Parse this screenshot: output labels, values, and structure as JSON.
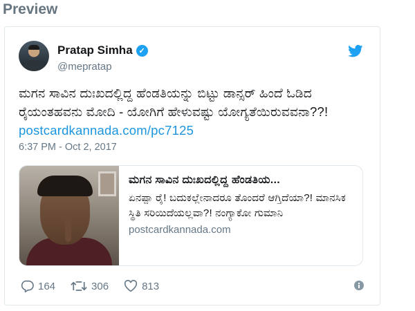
{
  "heading": "Preview",
  "tweet": {
    "display_name": "Pratap Simha",
    "handle": "@mepratap",
    "text_main": "ಮಗನ ಸಾವಿನ ದುಃಖದಲ್ಲಿದ್ದ ಹೆಂಡತಿಯನ್ನು ಬಿಟ್ಟು ಡಾನ್ಸರ್ ಹಿಂದೆ ಓಡಿದ ರೈಯಂತಹವನು ಮೋದಿ - ಯೋಗಿಗೆ ಹೇಳುವಷ್ಟು ಯೋಗ್ಯತೆಯಿರುವವನಾ??!",
    "text_link": "postcardkannada.com/pc7125",
    "timestamp": "6:37 PM - Oct 2, 2017",
    "card": {
      "title": "ಮಗನ ಸಾವಿನ ದುಃಖದಲ್ಲಿದ್ದ ಹೆಂಡತಿಯ...",
      "description": "ಏನಪ್ಪಾ ರೈ! ಬದುಕಲ್ಲೇನಾದರೂ ತೊಂದರೆ ಆಗ್ತಿದೆಯಾ?! ಮಾನಸಿಕ ಸ್ಥಿತಿ ಸರಿಯಿದೆಯಲ್ಲವಾ?! ನಂಗ್ಯಾಕೋ ಗುಮಾನಿ",
      "domain": "postcardkannada.com"
    },
    "stats": {
      "replies": "164",
      "retweets": "306",
      "likes": "813"
    }
  },
  "colors": {
    "accent": "#1da1f2",
    "link": "#1b95e0",
    "muted": "#657786",
    "heading": "#66757f"
  },
  "icons": [
    "verified-icon",
    "twitter-bird-icon",
    "reply-icon",
    "retweet-icon",
    "like-icon",
    "info-icon"
  ]
}
